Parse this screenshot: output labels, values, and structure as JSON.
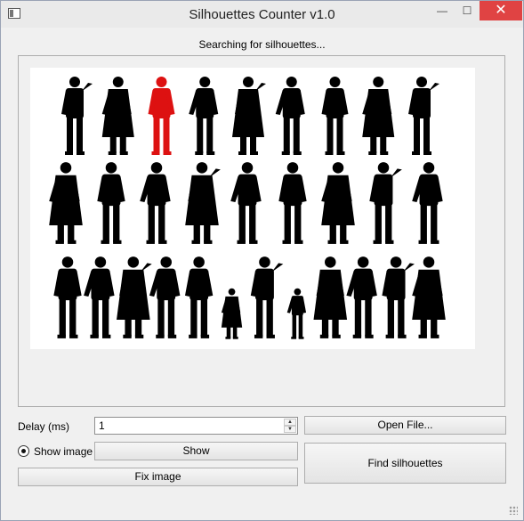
{
  "window": {
    "title": "Silhouettes Counter v1.0",
    "minimize_label": "—",
    "maximize_label": "☐",
    "close_label": "✕"
  },
  "status_text": "Searching for silhouettes...",
  "controls": {
    "delay_label": "Delay (ms)",
    "delay_value": "1",
    "open_file_label": "Open File...",
    "show_image_label": "Show image",
    "show_label": "Show",
    "fix_image_label": "Fix image",
    "find_label": "Find silhouettes"
  },
  "colors": {
    "highlight": "#dd1111",
    "silhouette": "#000000"
  },
  "image": {
    "rows": [
      9,
      9,
      12
    ],
    "highlighted": "row-0-col-2"
  }
}
